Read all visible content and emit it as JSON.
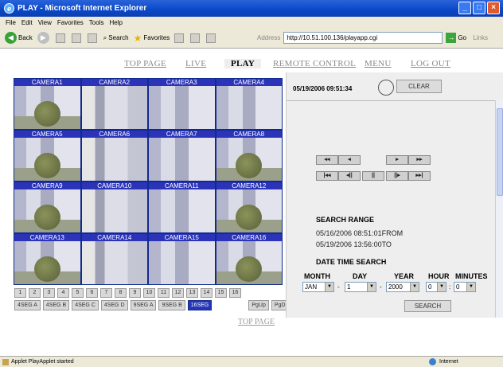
{
  "window": {
    "title": "PLAY - Microsoft Internet Explorer"
  },
  "menu": [
    "File",
    "Edit",
    "View",
    "Favorites",
    "Tools",
    "Help"
  ],
  "toolbar": {
    "back": "Back",
    "search": "Search",
    "favorites": "Favorites",
    "address_label": "Address",
    "address": "http://10.51.100.136/playapp.cgi",
    "go": "Go",
    "links": "Links"
  },
  "nav": [
    "TOP PAGE",
    "LIVE",
    "PLAY",
    "REMOTE CONTROL",
    "MENU",
    "LOG OUT"
  ],
  "nav_active": "PLAY",
  "cameras": [
    "CAMERA1",
    "CAMERA2",
    "CAMERA3",
    "CAMERA4",
    "CAMERA5",
    "CAMERA6",
    "CAMERA7",
    "CAMERA8",
    "CAMERA9",
    "CAMERA10",
    "CAMERA11",
    "CAMERA12",
    "CAMERA13",
    "CAMERA14",
    "CAMERA15",
    "CAMERA16"
  ],
  "camera_numbers": [
    "1",
    "2",
    "3",
    "4",
    "5",
    "6",
    "7",
    "8",
    "9",
    "10",
    "11",
    "12",
    "13",
    "14",
    "15",
    "16"
  ],
  "seg_buttons": [
    "4SEG A",
    "4SEG B",
    "4SEG C",
    "4SEG D",
    "9SEG A",
    "9SEG B",
    "16SEG"
  ],
  "seg_active": "16SEG",
  "page_buttons": [
    "PgUp",
    "PgDn"
  ],
  "bottom_link": "TOP PAGE",
  "panel": {
    "timestamp": "05/19/2006 09:51:34",
    "clear_label": "CLEAR",
    "playback_row1": [
      "◂◂",
      "◂",
      "▸",
      "▸▸"
    ],
    "playback_row2": [
      "|◂◂",
      "◂||",
      "||",
      "||▸",
      "▸▸|"
    ],
    "search_range_title": "SEARCH RANGE",
    "search_range_from": "05/16/2006 08:51:01FROM",
    "search_range_to": "05/19/2006 13:56:00TO",
    "date_time_search_title": "DATE TIME SEARCH",
    "field_labels": {
      "month": "MONTH",
      "day": "DAY",
      "year": "YEAR",
      "hour": "HOUR",
      "minutes": "MINUTES"
    },
    "field_values": {
      "month": "JAN",
      "day": "1",
      "year": "2000",
      "hour": "0",
      "minutes": "0"
    },
    "search_label": "SEARCH"
  },
  "status": {
    "text": "Applet PlayApplet started",
    "zone": "Internet"
  }
}
